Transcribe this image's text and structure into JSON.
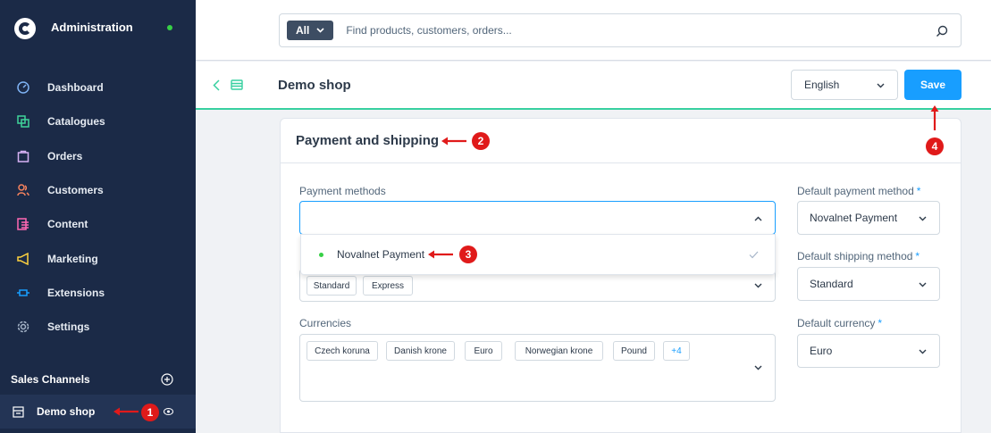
{
  "sidebar": {
    "title": "Administration",
    "items": [
      {
        "label": "Dashboard",
        "icon": "dashboard-gauge-icon"
      },
      {
        "label": "Catalogues",
        "icon": "catalogue-icon"
      },
      {
        "label": "Orders",
        "icon": "shopping-bag-icon"
      },
      {
        "label": "Customers",
        "icon": "users-icon"
      },
      {
        "label": "Content",
        "icon": "content-icon"
      },
      {
        "label": "Marketing",
        "icon": "megaphone-icon"
      },
      {
        "label": "Extensions",
        "icon": "plug-icon"
      },
      {
        "label": "Settings",
        "icon": "gear-icon"
      }
    ],
    "sales_channels_label": "Sales Channels",
    "active_channel": "Demo shop"
  },
  "search": {
    "type_label": "All",
    "placeholder": "Find products, customers, orders..."
  },
  "smartbar": {
    "title": "Demo shop",
    "language": "English",
    "save_label": "Save"
  },
  "card": {
    "title": "Payment and shipping",
    "payment_methods_label": "Payment methods",
    "default_payment_label": "Default payment method",
    "default_payment_value": "Novalnet Payment",
    "default_shipping_label": "Default shipping method",
    "default_shipping_value": "Standard",
    "shipping_chips": [
      "Standard",
      "Express"
    ],
    "currencies_label": "Currencies",
    "currency_chips": [
      "Czech koruna",
      "Danish krone",
      "Euro",
      "Norwegian krone",
      "Pound",
      "+4"
    ],
    "default_currency_label": "Default currency",
    "default_currency_value": "Euro",
    "required_marker": "*"
  },
  "dropdown": {
    "option_label": "Novalnet Payment"
  },
  "annotations": [
    "1",
    "2",
    "3",
    "4"
  ],
  "colors": {
    "sidebar_bg": "#1b2a47",
    "accent": "#189eff",
    "success": "#37d046",
    "annotation": "#e01a1a",
    "smartbar_border": "#37d0a0"
  }
}
